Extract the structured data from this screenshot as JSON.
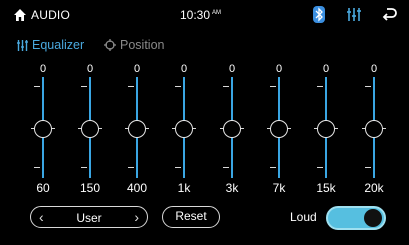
{
  "status_bar": {
    "title": "AUDIO",
    "time": "10:30",
    "ampm": "AM",
    "icons": [
      "home-icon",
      "bluetooth-icon",
      "equalizer-icon",
      "back-icon"
    ],
    "accent_color": "#4aa9df"
  },
  "tabs": [
    {
      "label": "Equalizer",
      "icon": "equalizer-icon",
      "active": true
    },
    {
      "label": "Position",
      "icon": "position-icon",
      "active": false
    }
  ],
  "equalizer": {
    "bands": [
      {
        "freq": "60",
        "value": "0"
      },
      {
        "freq": "150",
        "value": "0"
      },
      {
        "freq": "400",
        "value": "0"
      },
      {
        "freq": "1k",
        "value": "0"
      },
      {
        "freq": "3k",
        "value": "0"
      },
      {
        "freq": "7k",
        "value": "0"
      },
      {
        "freq": "15k",
        "value": "0"
      },
      {
        "freq": "20k",
        "value": "0"
      }
    ]
  },
  "controls": {
    "preset": "User",
    "reset_label": "Reset",
    "loud_label": "Loud",
    "loud_on": true
  }
}
